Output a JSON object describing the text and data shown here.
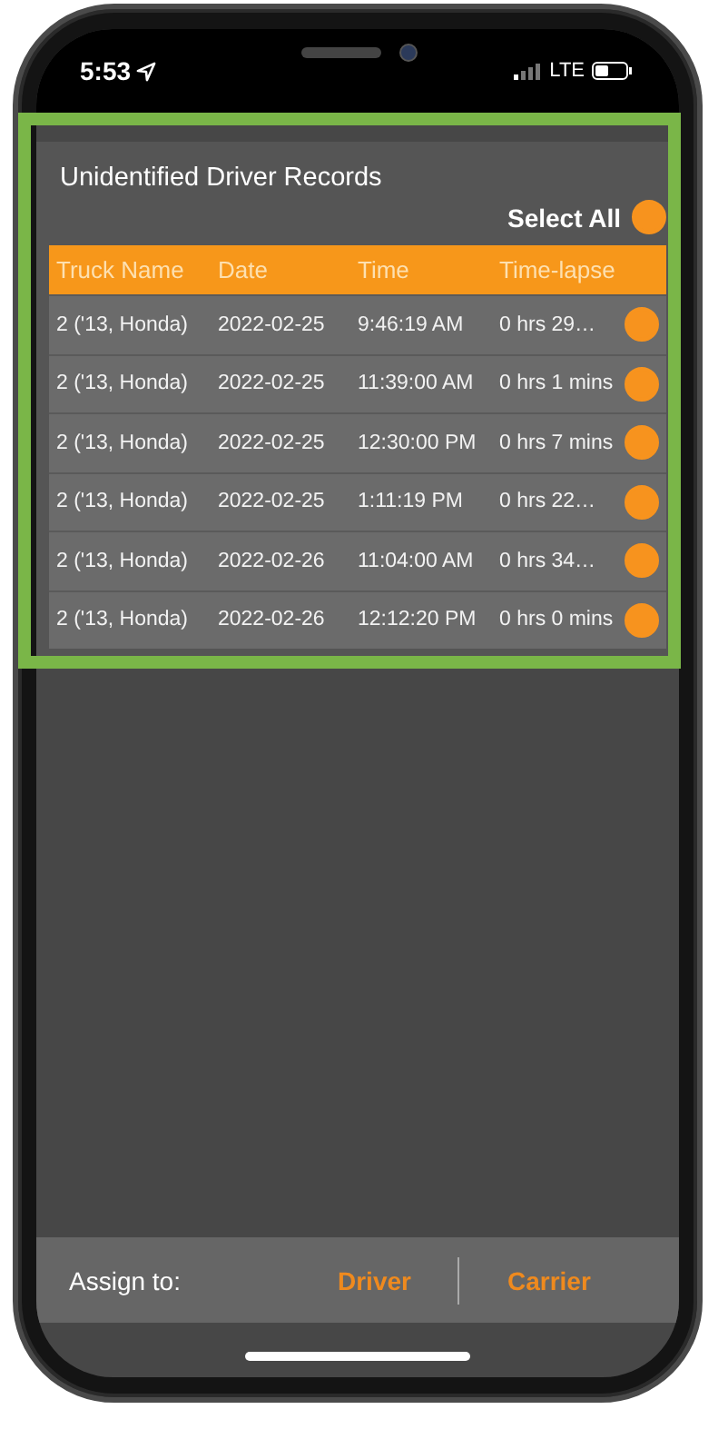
{
  "status_bar": {
    "time": "5:53",
    "network": "LTE"
  },
  "title": "Unidentified Driver Records",
  "select_all": {
    "label": "Select All",
    "checked": true
  },
  "table": {
    "columns": [
      "Truck Name",
      "Date",
      "Time",
      "Time-lapse"
    ],
    "rows": [
      {
        "truck": "2 ('13, Honda)",
        "date": "2022-02-25",
        "time": "9:46:19 AM",
        "lapse": "0 hrs 29…",
        "checked": true
      },
      {
        "truck": "2 ('13, Honda)",
        "date": "2022-02-25",
        "time": "11:39:00 AM",
        "lapse": "0 hrs 1 mins",
        "checked": true
      },
      {
        "truck": "2 ('13, Honda)",
        "date": "2022-02-25",
        "time": "12:30:00 PM",
        "lapse": "0 hrs 7 mins",
        "checked": true
      },
      {
        "truck": "2 ('13, Honda)",
        "date": "2022-02-25",
        "time": "1:11:19 PM",
        "lapse": "0 hrs 22…",
        "checked": true
      },
      {
        "truck": "2 ('13, Honda)",
        "date": "2022-02-26",
        "time": "11:04:00 AM",
        "lapse": "0 hrs 34…",
        "checked": true
      },
      {
        "truck": "2 ('13, Honda)",
        "date": "2022-02-26",
        "time": "12:12:20 PM",
        "lapse": "0 hrs 0 mins",
        "checked": true
      }
    ]
  },
  "assign_bar": {
    "label": "Assign to:",
    "options": [
      "Driver",
      "Carrier"
    ]
  }
}
